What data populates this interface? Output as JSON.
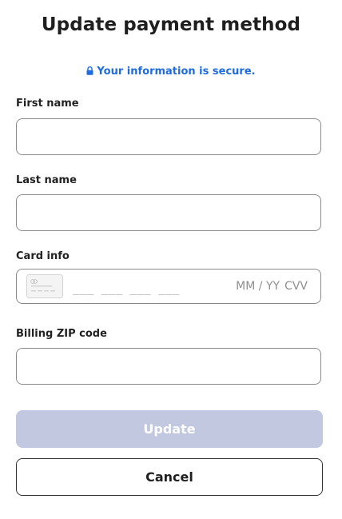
{
  "header": {
    "title": "Update payment method",
    "secure_text": "Your information is secure.",
    "secure_icon": "lock-icon",
    "secure_color": "#1f6be0"
  },
  "form": {
    "first_name": {
      "label": "First name",
      "value": "",
      "placeholder": ""
    },
    "last_name": {
      "label": "Last name",
      "value": "",
      "placeholder": ""
    },
    "card_info": {
      "label": "Card info",
      "card_icon": "credit-card-icon",
      "number_placeholder": "___ ___ ___ ___",
      "expiry_placeholder": "MM / YY",
      "cvv_placeholder": "CVV"
    },
    "billing_zip": {
      "label": "Billing ZIP code",
      "value": "",
      "placeholder": ""
    }
  },
  "actions": {
    "update_label": "Update",
    "update_color": "#c2c8e0",
    "cancel_label": "Cancel"
  }
}
